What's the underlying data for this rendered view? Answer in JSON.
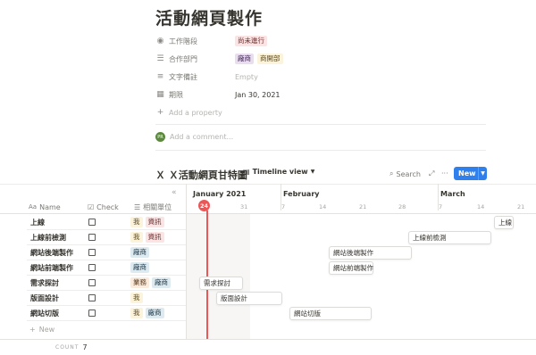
{
  "page": {
    "title": "活動網頁製作",
    "properties": [
      {
        "label": "工作階段",
        "icon": "status-icon",
        "tags": [
          {
            "text": "尚未進行",
            "bg": "#fbe4e4",
            "fg": "#6b2c2c"
          }
        ]
      },
      {
        "label": "合作部門",
        "icon": "list-icon",
        "tags": [
          {
            "text": "廠商",
            "bg": "#e8deee",
            "fg": "#412454"
          },
          {
            "text": "商開部",
            "bg": "#fbf3db",
            "fg": "#5c4a1a"
          }
        ]
      },
      {
        "label": "文字備註",
        "icon": "text-icon",
        "value": "Empty"
      },
      {
        "label": "期限",
        "icon": "calendar-icon",
        "value": "Jan 30, 2021"
      }
    ],
    "add_property": "Add a property",
    "comment_placeholder": "Add a comment...",
    "avatar_initials": "PR"
  },
  "database": {
    "title": "Ｘ Ｘ活動網頁甘特圖",
    "view_label": "Timeline view",
    "search_label": "Search",
    "new_label": "New",
    "collapse_icon": "double-chevron-left-icon",
    "columns": {
      "name": "Name",
      "check": "Check",
      "unit": "相關單位"
    },
    "rows": [
      {
        "name": "上線",
        "tags": [
          "我",
          "資訊"
        ]
      },
      {
        "name": "上線前檢測",
        "tags": [
          "我",
          "資訊"
        ]
      },
      {
        "name": "網站後端製作",
        "tags": [
          "廠商"
        ]
      },
      {
        "name": "網站前端製作",
        "tags": [
          "廠商"
        ]
      },
      {
        "name": "需求探討",
        "tags": [
          "業務",
          "廠商"
        ]
      },
      {
        "name": "版面設計",
        "tags": [
          "我"
        ]
      },
      {
        "name": "網站切版",
        "tags": [
          "我",
          "廠商"
        ]
      }
    ],
    "new_row": "New",
    "count_label": "COUNT",
    "count_value": "7"
  },
  "timeline": {
    "months": [
      {
        "label": "January 2021"
      },
      {
        "label": "February"
      },
      {
        "label": "March"
      }
    ],
    "days": [
      "24",
      "31",
      "7",
      "14",
      "21",
      "28",
      "7",
      "14",
      "21"
    ],
    "today": "24",
    "bars": [
      {
        "label": "上線"
      },
      {
        "label": "上線前檢測"
      },
      {
        "label": "網站後端製作"
      },
      {
        "label": "網站前端製作"
      },
      {
        "label": "需求探討"
      },
      {
        "label": "版面設計"
      },
      {
        "label": "網站切版"
      }
    ]
  },
  "tag_colors": {
    "我": {
      "bg": "#fbf3db",
      "fg": "#5c4a1a"
    },
    "資訊": {
      "bg": "#fbe4e4",
      "fg": "#6b2c2c"
    },
    "廠商": {
      "bg": "#ddebf1",
      "fg": "#183347"
    },
    "業務": {
      "bg": "#faebdd",
      "fg": "#5c3b1e"
    }
  }
}
